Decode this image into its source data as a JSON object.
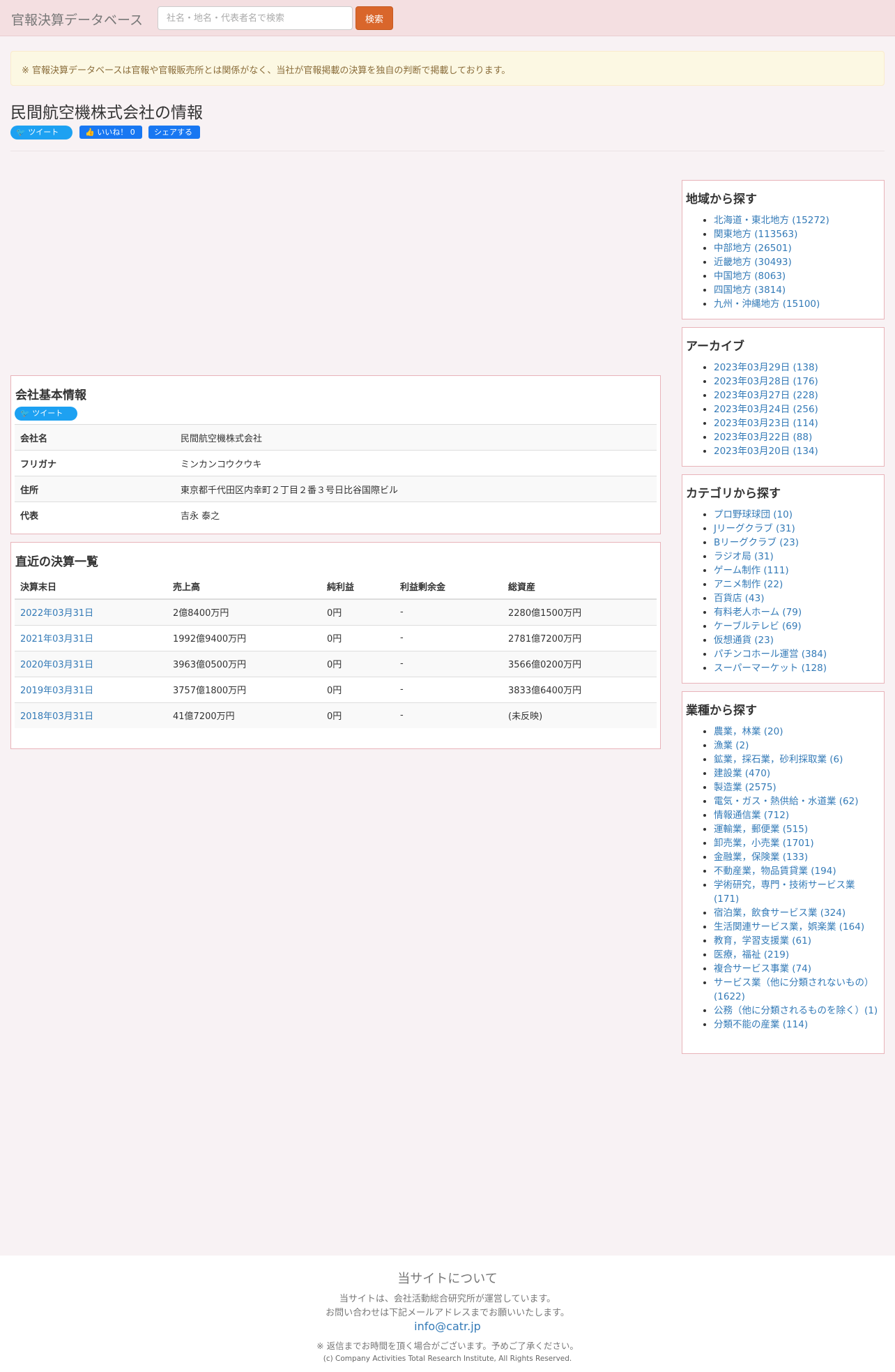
{
  "nav": {
    "brand": "官報決算データベース",
    "search_placeholder": "社名・地名・代表者名で検索",
    "search_button": "検索"
  },
  "notice": "※ 官報決算データベースは官報や官報販売所とは関係がなく、当社が官報掲載の決算を独自の判断で掲載しております。",
  "page_title": "民間航空機株式会社の情報",
  "social": {
    "tweet": "ツイート",
    "like": "いいね！ 0",
    "share": "シェアする"
  },
  "company": {
    "heading": "会社基本情報",
    "tweet": "ツイート",
    "rows": [
      {
        "label": "会社名",
        "value": "民間航空機株式会社"
      },
      {
        "label": "フリガナ",
        "value": "ミンカンコウクウキ"
      },
      {
        "label": "住所",
        "value": "東京都千代田区内幸町２丁目２番３号日比谷国際ビル"
      },
      {
        "label": "代表",
        "value": "吉永 泰之"
      }
    ]
  },
  "results": {
    "heading": "直近の決算一覧",
    "columns": [
      "決算末日",
      "売上高",
      "純利益",
      "利益剰余金",
      "総資産"
    ],
    "rows": [
      [
        "2022年03月31日",
        "2億8400万円",
        "0円",
        "-",
        "2280億1500万円"
      ],
      [
        "2021年03月31日",
        "1992億9400万円",
        "0円",
        "-",
        "2781億7200万円"
      ],
      [
        "2020年03月31日",
        "3963億0500万円",
        "0円",
        "-",
        "3566億0200万円"
      ],
      [
        "2019年03月31日",
        "3757億1800万円",
        "0円",
        "-",
        "3833億6400万円"
      ],
      [
        "2018年03月31日",
        "41億7200万円",
        "0円",
        "-",
        "(未反映)"
      ]
    ]
  },
  "sidebar": {
    "region": {
      "title": "地域から探す",
      "items": [
        "北海道・東北地方 (15272)",
        "関東地方 (113563)",
        "中部地方 (26501)",
        "近畿地方 (30493)",
        "中国地方 (8063)",
        "四国地方 (3814)",
        "九州・沖縄地方 (15100)"
      ]
    },
    "archive": {
      "title": "アーカイブ",
      "items": [
        "2023年03月29日 (138)",
        "2023年03月28日 (176)",
        "2023年03月27日 (228)",
        "2023年03月24日 (256)",
        "2023年03月23日 (114)",
        "2023年03月22日 (88)",
        "2023年03月20日 (134)"
      ]
    },
    "category": {
      "title": "カテゴリから探す",
      "items": [
        "プロ野球球団 (10)",
        "Jリーグクラブ (31)",
        "Bリーグクラブ (23)",
        "ラジオ局 (31)",
        "ゲーム制作 (111)",
        "アニメ制作 (22)",
        "百貨店 (43)",
        "有料老人ホーム (79)",
        "ケーブルテレビ (69)",
        "仮想通貨 (23)",
        "パチンコホール運営 (384)",
        "スーパーマーケット (128)"
      ]
    },
    "industry": {
      "title": "業種から探す",
      "items": [
        "農業，林業 (20)",
        "漁業 (2)",
        "鉱業，採石業，砂利採取業 (6)",
        "建設業 (470)",
        "製造業 (2575)",
        "電気・ガス・熱供給・水道業 (62)",
        "情報通信業 (712)",
        "運輸業，郵便業 (515)",
        "卸売業，小売業 (1701)",
        "金融業，保険業 (133)",
        "不動産業，物品賃貸業 (194)",
        "学術研究，専門・技術サービス業 (171)",
        "宿泊業，飲食サービス業 (324)",
        "生活関連サービス業，娯楽業 (164)",
        "教育，学習支援業 (61)",
        "医療，福祉 (219)",
        "複合サービス事業 (74)",
        "サービス業（他に分類されないもの）(1622)",
        "公務（他に分類されるものを除く）(1)",
        "分類不能の産業 (114)"
      ]
    }
  },
  "footer": {
    "title": "当サイトについて",
    "line1": "当サイトは、会社活動総合研究所が運営しています。",
    "line2": "お問い合わせは下記メールアドレスまでお願いいたします。",
    "email": "info@catr.jp",
    "note": "※ 返信までお時間を頂く場合がございます。予めご了承ください。",
    "copyright": "(c) Company Activities Total Research Institute, All Rights Reserved."
  }
}
